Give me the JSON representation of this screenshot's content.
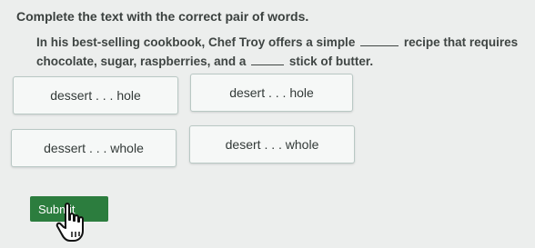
{
  "instruction": "Complete the text with the correct pair of words.",
  "passage": {
    "line1_before": "In his best-selling cookbook, Chef Troy offers a simple",
    "line1_after": "recipe that requires",
    "line2_before": "chocolate, sugar, raspberries, and a",
    "line2_after": "stick of butter."
  },
  "choices": [
    {
      "label": "dessert . . . hole"
    },
    {
      "label": "desert . . . hole"
    },
    {
      "label": "dessert . . . whole"
    },
    {
      "label": "desert . . . whole"
    }
  ],
  "submit_label": "Submit",
  "icons": {
    "cursor": "hand-pointer-icon"
  },
  "colors": {
    "submit": "#2c7d3e",
    "background": "#eceeed",
    "choice_border": "#b9c8c4"
  }
}
